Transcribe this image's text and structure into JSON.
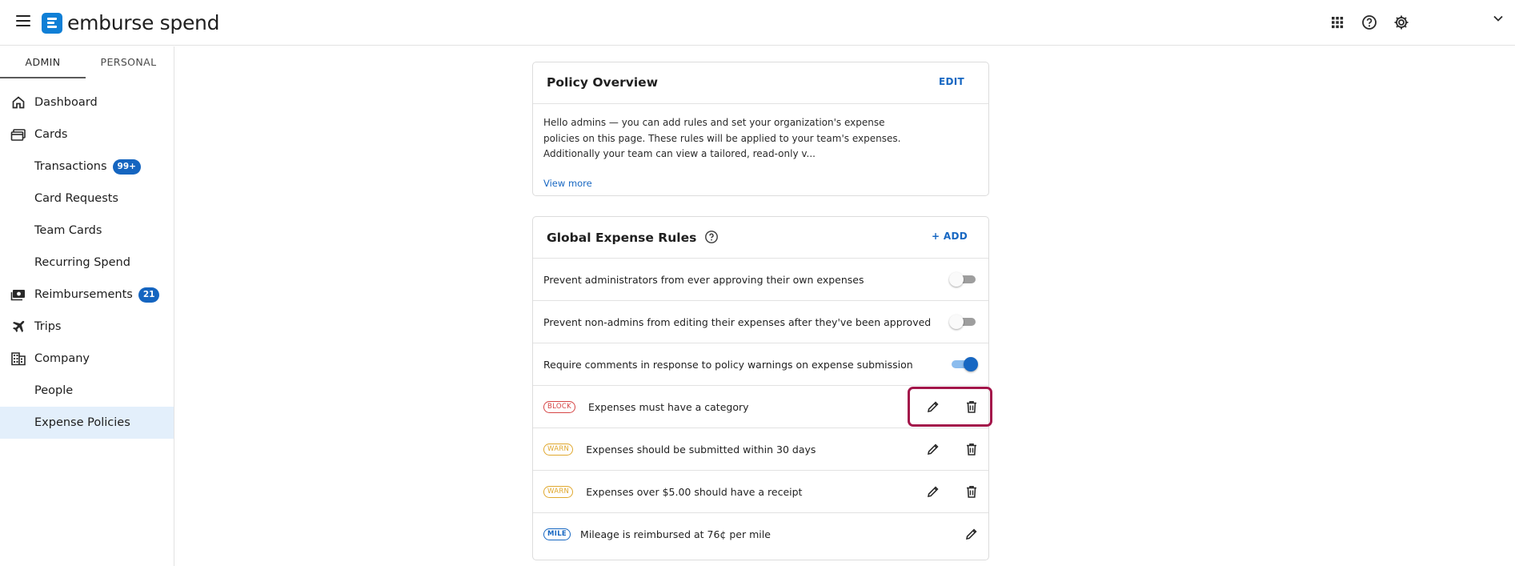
{
  "app": {
    "brand": "emburse spend",
    "accent": "#0f7fd6"
  },
  "topbar": {
    "apps_icon": "grid-icon",
    "help_icon": "help-icon",
    "settings_icon": "gear-icon",
    "menu_icon": "chevron-down-icon"
  },
  "sidebar": {
    "tabs": [
      {
        "label": "ADMIN",
        "active": true
      },
      {
        "label": "PERSONAL",
        "active": false
      }
    ],
    "items": [
      {
        "label": "Dashboard",
        "icon": "home-icon"
      },
      {
        "label": "Cards",
        "icon": "cards-icon"
      },
      {
        "label": "Transactions",
        "badge": "99+"
      },
      {
        "label": "Card Requests"
      },
      {
        "label": "Team Cards"
      },
      {
        "label": "Recurring Spend"
      },
      {
        "label": "Reimbursements",
        "icon": "cash-icon",
        "badge": "21"
      },
      {
        "label": "Trips",
        "icon": "plane-icon"
      },
      {
        "label": "Company",
        "icon": "building-icon"
      },
      {
        "label": "People"
      },
      {
        "label": "Expense Policies",
        "active": true
      }
    ]
  },
  "overview": {
    "title": "Policy Overview",
    "action": "EDIT",
    "body": "Hello admins — you can add rules and set your organization's expense policies on this page. These rules will be applied to your team's expenses. Additionally your team can view a tailored, read-only v...",
    "view_more": "View more"
  },
  "rules": {
    "title": "Global Expense Rules",
    "action": "+ ADD",
    "toggles": [
      {
        "text": "Prevent administrators from ever approving their own expenses",
        "enabled": false
      },
      {
        "text": "Prevent non-admins from editing their expenses after they've been approved",
        "enabled": false
      },
      {
        "text": "Require comments in response to policy warnings on expense submission",
        "enabled": true
      }
    ],
    "items": [
      {
        "tag": "BLOCK",
        "text": "Expenses must have a category"
      },
      {
        "tag": "WARN",
        "text": "Expenses should be submitted within 30 days"
      },
      {
        "tag": "WARN",
        "text": "Expenses over $5.00 should have a receipt"
      },
      {
        "tag": "MILE",
        "text": "Mileage is reimbursed at 76¢ per mile"
      }
    ]
  }
}
